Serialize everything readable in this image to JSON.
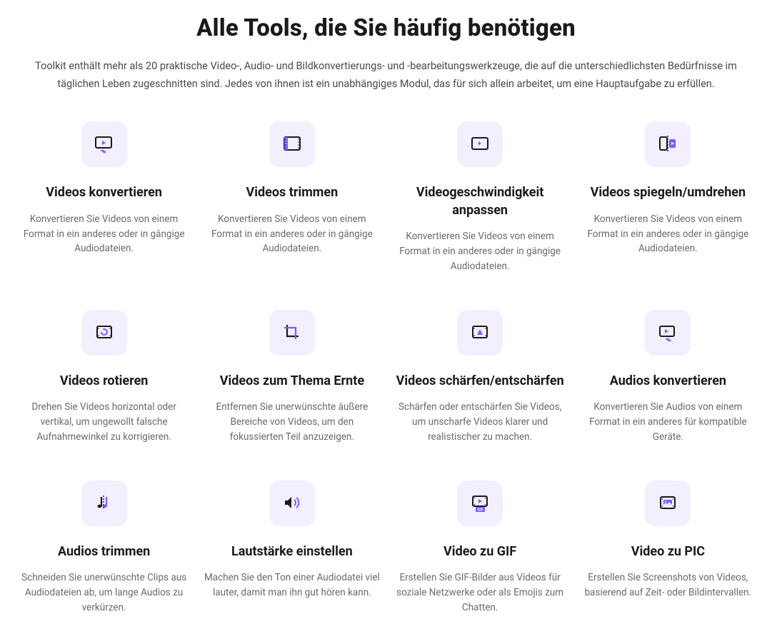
{
  "header": {
    "title": "Alle Tools, die Sie häufig benötigen",
    "subtitle": "Toolkit enthält mehr als 20 praktische Video-, Audio- und Bildkonvertierungs- und -bearbeitungswerkzeuge, die auf die unterschiedlichsten Bedürfnisse im täglichen Leben zugeschnitten sind. Jedes von ihnen ist ein unabhängiges Modul, das für sich allein arbeitet, um eine Hauptaufgabe zu erfüllen."
  },
  "tools": [
    {
      "title": "Videos konvertieren",
      "desc": "Konvertieren Sie Videos von einem Format in ein anderes oder in gängige Audiodateien.",
      "icon": "video-convert"
    },
    {
      "title": "Videos trimmen",
      "desc": "Konvertieren Sie Videos von einem Format in ein anderes oder in gängige Audiodateien.",
      "icon": "video-trim"
    },
    {
      "title": "Videogeschwindigkeit anpassen",
      "desc": "Konvertieren Sie Videos von einem Format in ein anderes oder in gängige Audiodateien.",
      "icon": "video-speed"
    },
    {
      "title": "Videos spiegeln/umdrehen",
      "desc": "Konvertieren Sie Videos von einem Format in ein anderes oder in gängige Audiodateien.",
      "icon": "video-mirror"
    },
    {
      "title": "Videos rotieren",
      "desc": "Drehen Sie Videos horizontal oder vertikal, um ungewollt falsche Aufnahmewinkel zu korrigieren.",
      "icon": "video-rotate"
    },
    {
      "title": "Videos zum Thema Ernte",
      "desc": "Entfernen Sie unerwünschte äußere Bereiche von Videos, um den fokussierten Teil anzuzeigen.",
      "icon": "video-crop"
    },
    {
      "title": "Videos schärfen/entschärfen",
      "desc": "Schärfen oder entschärfen Sie Videos, um unscharfe Videos klarer und realistischer zu machen.",
      "icon": "video-sharpen"
    },
    {
      "title": "Audios konvertieren",
      "desc": "Konvertieren Sie Audios von einem Format in ein anderes für kompatible Geräte.",
      "icon": "audio-convert"
    },
    {
      "title": "Audios trimmen",
      "desc": "Schneiden Sie unerwünschte Clips aus Audiodateien ab, um lange Audios zu verkürzen.",
      "icon": "audio-trim"
    },
    {
      "title": "Lautstärke einstellen",
      "desc": "Machen Sie den Ton einer Audiodatei viel lauter, damit man ihn gut hören kann.",
      "icon": "volume"
    },
    {
      "title": "Video zu GIF",
      "desc": "Erstellen Sie GIF-Bilder aus Videos für soziale Netzwerke oder als Emojis zum Chatten.",
      "icon": "video-gif"
    },
    {
      "title": "Video zu PIC",
      "desc": "Erstellen Sie Screenshots von Videos, basierend auf Zeit- oder Bildintervallen.",
      "icon": "video-pic"
    }
  ]
}
